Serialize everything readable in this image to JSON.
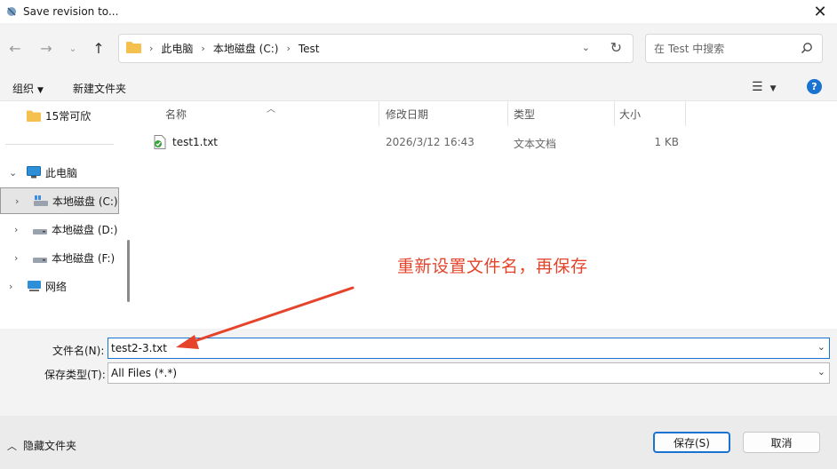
{
  "window": {
    "title": "Save revision to..."
  },
  "nav": {
    "breadcrumb": [
      "此电脑",
      "本地磁盘 (C:)",
      "Test"
    ],
    "search_placeholder": "在 Test 中搜索"
  },
  "toolbar": {
    "organize_label": "组织",
    "new_folder_label": "新建文件夹"
  },
  "sidebar": {
    "pinned_item": "15常可欣",
    "this_pc": "此电脑",
    "drives": [
      "本地磁盘 (C:)",
      "本地磁盘 (D:)",
      "本地磁盘 (F:)"
    ],
    "network": "网络",
    "selected": "本地磁盘 (C:)"
  },
  "columns": {
    "name": "名称",
    "modified": "修改日期",
    "type": "类型",
    "size": "大小"
  },
  "files": [
    {
      "name": "test1.txt",
      "modified": "2026/3/12 16:43",
      "type": "文本文档",
      "size": "1 KB"
    }
  ],
  "annotation": {
    "text": "重新设置文件名，再保存",
    "color": "#e5442b"
  },
  "form": {
    "filename_label": "文件名(N):",
    "filename_value": "test2-3.txt",
    "filetype_label": "保存类型(T):",
    "filetype_value": "All Files (*.*)"
  },
  "footer": {
    "hide_folders_label": "隐藏文件夹",
    "save_label": "保存(S)",
    "cancel_label": "取消"
  },
  "colors": {
    "accent": "#1a73d1",
    "annotation": "#e5442b",
    "folder": "#f4c04e"
  }
}
